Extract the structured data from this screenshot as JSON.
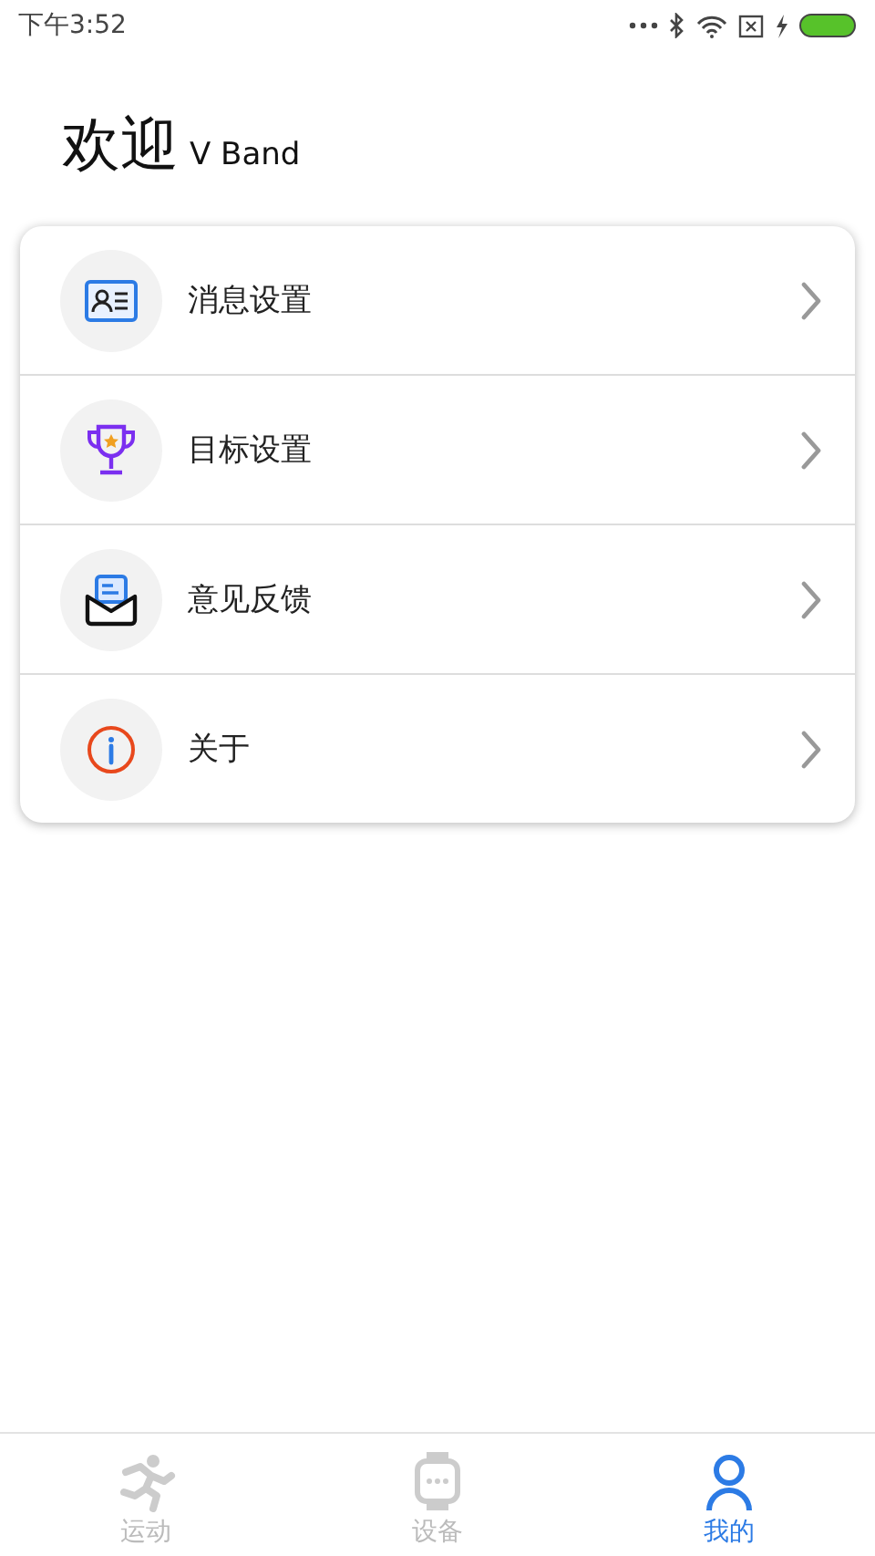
{
  "status_bar": {
    "time": "下午3:52"
  },
  "header": {
    "title": "欢迎",
    "subtitle": "V Band"
  },
  "menu": [
    {
      "kind": "message",
      "label": "消息设置"
    },
    {
      "kind": "goal",
      "label": "目标设置"
    },
    {
      "kind": "feedback",
      "label": "意见反馈"
    },
    {
      "kind": "about",
      "label": "关于"
    }
  ],
  "tabs": [
    {
      "kind": "sport",
      "label": "运动",
      "selected": false
    },
    {
      "kind": "device",
      "label": "设备",
      "selected": false
    },
    {
      "kind": "me",
      "label": "我的",
      "selected": true
    }
  ]
}
